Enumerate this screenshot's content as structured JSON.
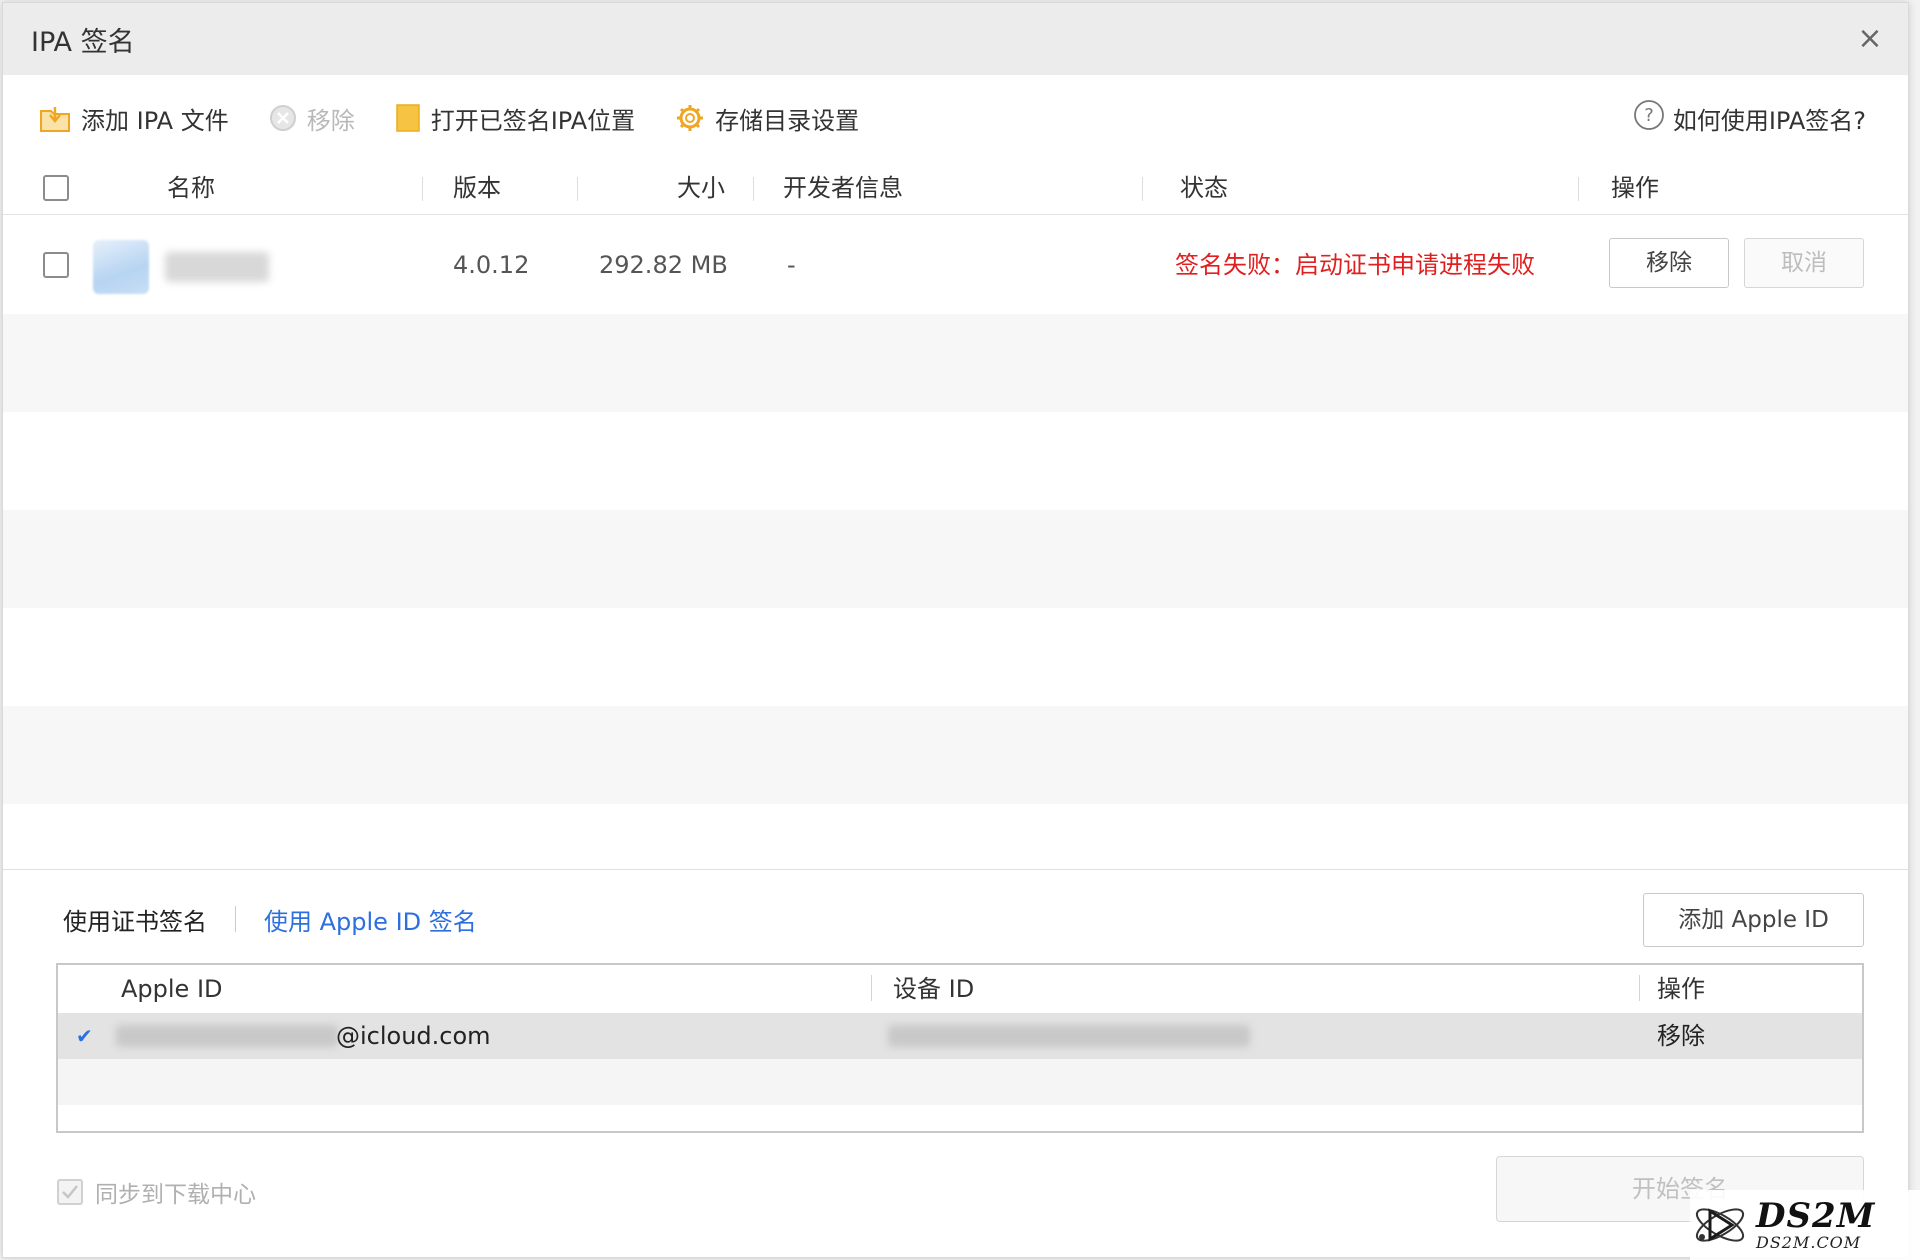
{
  "window": {
    "title": "IPA 签名",
    "close_glyph": "×"
  },
  "toolbar": {
    "add_label": "添加 IPA 文件",
    "remove_label": "移除",
    "open_signed_label": "打开已签名IPA位置",
    "storage_label": "存储目录设置",
    "help_label": "如何使用IPA签名?"
  },
  "table": {
    "headers": {
      "name": "名称",
      "version": "版本",
      "size": "大小",
      "developer": "开发者信息",
      "status": "状态",
      "actions": "操作"
    },
    "rows": [
      {
        "version": "4.0.12",
        "size": "292.82 MB",
        "developer": "-",
        "status": "签名失败：启动证书申请进程失败",
        "remove_label": "移除",
        "cancel_label": "取消"
      }
    ]
  },
  "signing": {
    "tab_certificate": "使用证书签名",
    "tab_apple_id": "使用 Apple ID 签名",
    "add_apple_id_label": "添加 Apple ID",
    "table_headers": {
      "apple_id": "Apple ID",
      "device_id": "设备 ID",
      "actions": "操作"
    },
    "accounts": [
      {
        "email_suffix": "@icloud.com",
        "remove_label": "移除",
        "selected_mark": "✔"
      }
    ]
  },
  "footer": {
    "sync_label": "同步到下载中心",
    "start_label": "开始签名"
  },
  "watermark": {
    "big": "DS2M",
    "small": "DS2M.COM"
  },
  "colors": {
    "error": "#e02020",
    "link": "#2d6fe0",
    "folder_icon": "#f6c343",
    "gear_icon": "#f0a623",
    "check_mark": "#2d6fe0"
  }
}
